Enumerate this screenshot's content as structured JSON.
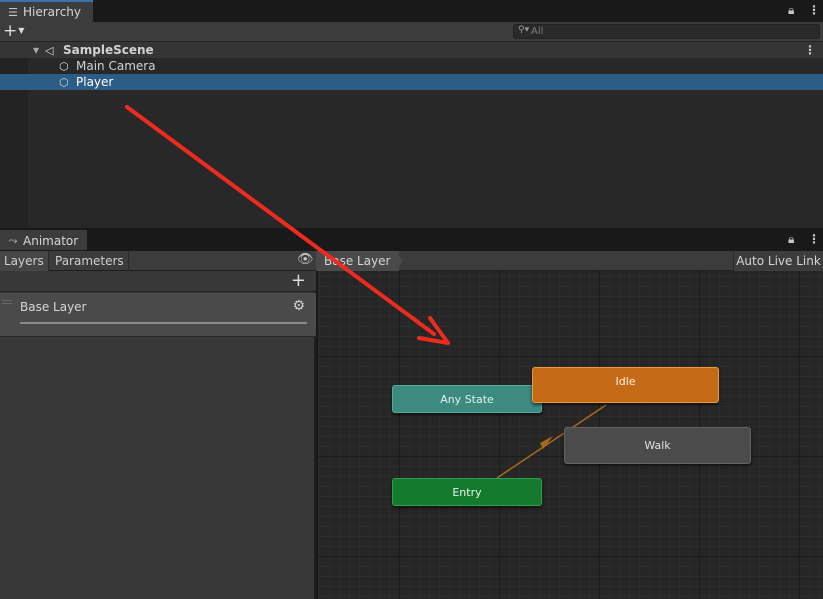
{
  "hierarchy": {
    "tab_label": "Hierarchy",
    "tab_icon": "list-icon",
    "search_placeholder": "All",
    "scene": {
      "name": "SampleScene"
    },
    "items": [
      {
        "label": "Main Camera",
        "selected": false
      },
      {
        "label": "Player",
        "selected": true
      }
    ]
  },
  "animator": {
    "tab_label": "Animator",
    "subtabs": [
      "Layers",
      "Parameters"
    ],
    "breadcrumb": "Base Layer",
    "live_link_label": "Auto Live Link",
    "layers": [
      {
        "name": "Base Layer"
      }
    ],
    "states": {
      "any_state": "Any State",
      "idle": "Idle",
      "walk": "Walk",
      "entry": "Entry"
    }
  },
  "colors": {
    "selection": "#2c5d87",
    "idle_state": "#c56a16",
    "any_state": "#3d8a80",
    "entry_state": "#137a2e",
    "walk_state": "#4b4b4b",
    "transition": "#a86a1c",
    "annotation_arrow": "#ee2b1e"
  }
}
